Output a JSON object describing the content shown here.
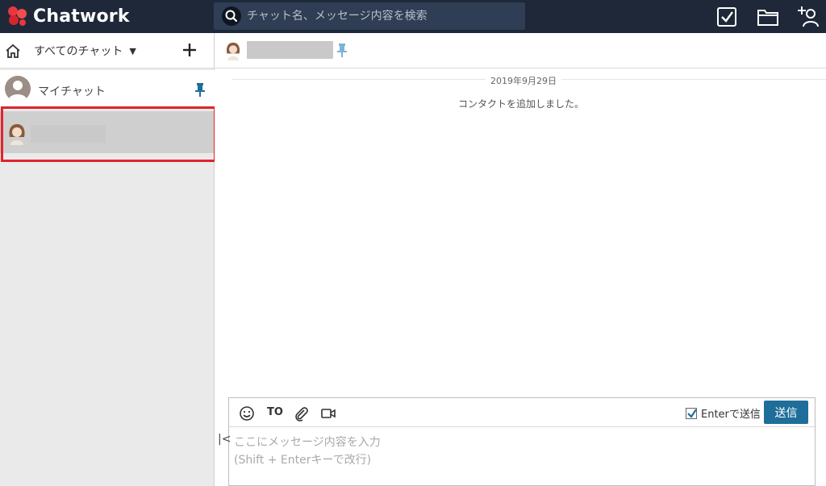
{
  "app": {
    "name": "Chatwork",
    "colors": {
      "topbar": "#1e2838",
      "search_bg": "#2f3d55",
      "accent": "#1f6e9a",
      "highlight": "#e0232b"
    }
  },
  "search": {
    "placeholder": "チャット名、メッセージ内容を検索",
    "icon": "search-icon"
  },
  "topbar_icons": [
    "task-check-icon",
    "folder-icon",
    "add-contact-icon"
  ],
  "sidebar": {
    "filter_label": "すべてのチャット",
    "caret": "▼",
    "rooms": [
      {
        "label": "マイチャット",
        "pinned": true
      },
      {
        "label": "",
        "selected": true
      }
    ]
  },
  "main": {
    "date": "2019年9月29日",
    "system_message": "コンタクトを追加しました。"
  },
  "composer": {
    "to_label": "TO",
    "enter_send_label": "Enterで送信",
    "enter_send_checked": true,
    "send_label": "送信",
    "placeholder": "ここにメッセージ内容を入力\n(Shift + Enterキーで改行)"
  },
  "collapse_label": "|<"
}
